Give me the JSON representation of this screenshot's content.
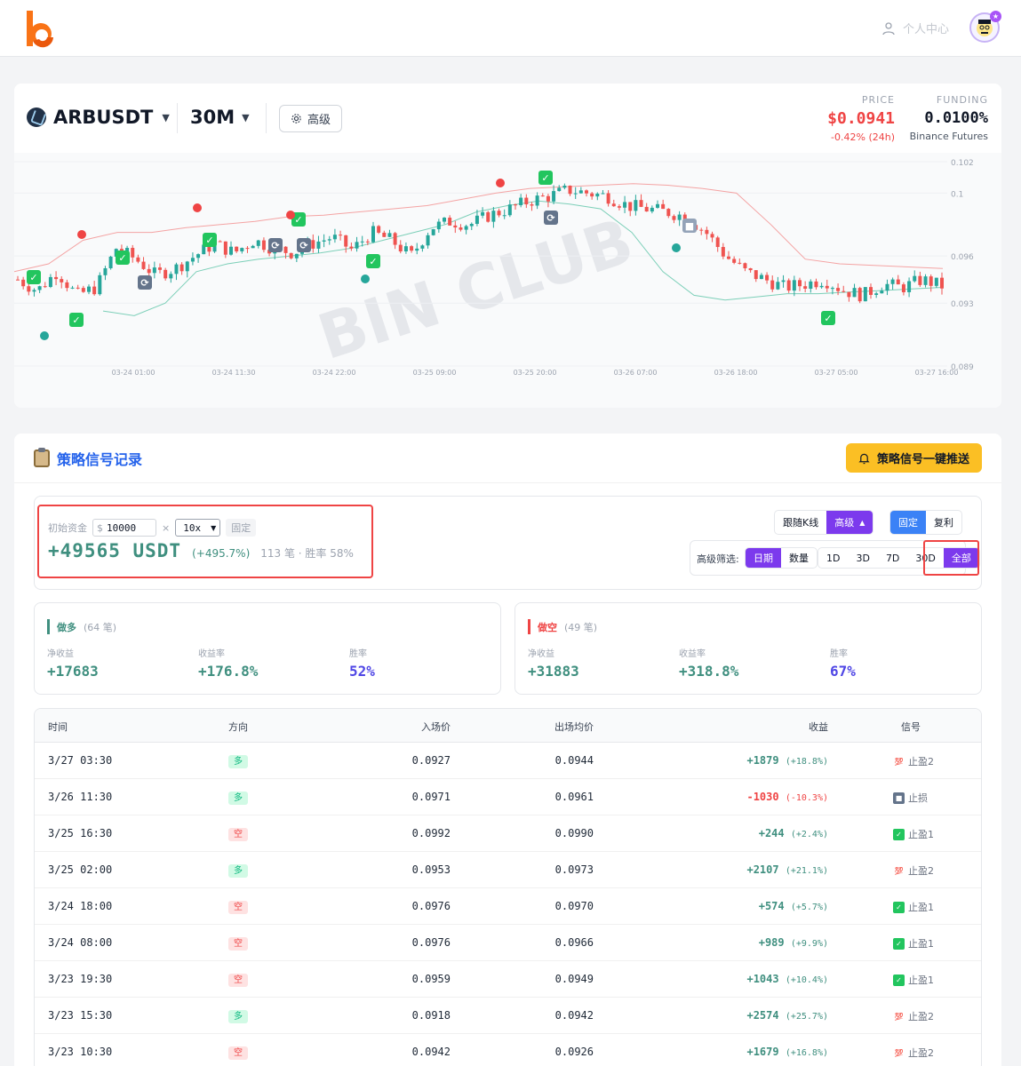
{
  "header": {
    "user_center": "个人中心"
  },
  "ticker": {
    "symbol": "ARBUSDT",
    "timeframe": "30M",
    "advanced_label": "高级",
    "price_label": "PRICE",
    "price": "$0.0941",
    "change": "-0.42% (24h)",
    "funding_label": "FUNDING",
    "funding": "0.0100%",
    "exchange": "Binance Futures"
  },
  "chart_data": {
    "type": "candlestick",
    "watermark": "BIN CLUB",
    "y_ticks": [
      "0.102",
      "0.1",
      "0.096",
      "0.093",
      "0.089"
    ],
    "x_ticks": [
      "03-24 01:00",
      "03-24 11:30",
      "03-24 22:00",
      "03-25 09:00",
      "03-25 20:00",
      "03-26 07:00",
      "03-26 18:00",
      "03-27 05:00",
      "03-27 16:00"
    ],
    "ylim": [
      0.089,
      0.102
    ],
    "close_path": [
      0.0945,
      0.0938,
      0.095,
      0.0935,
      0.094,
      0.0965,
      0.0958,
      0.0948,
      0.0952,
      0.096,
      0.0968,
      0.0962,
      0.097,
      0.0965,
      0.0962,
      0.0968,
      0.0972,
      0.0964,
      0.0975,
      0.097,
      0.096,
      0.0978,
      0.0982,
      0.098,
      0.0986,
      0.099,
      0.0995,
      0.0998,
      0.1002,
      0.1,
      0.0998,
      0.0992,
      0.099,
      0.0988,
      0.0985,
      0.0975,
      0.096,
      0.095,
      0.0945,
      0.094,
      0.0942,
      0.0945,
      0.0938,
      0.0935,
      0.0942,
      0.094,
      0.0945,
      0.0941
    ],
    "upper_band": [
      0.095,
      0.0955,
      0.097,
      0.0975,
      0.0975,
      0.0978,
      0.098,
      0.0982,
      0.0985,
      0.0986,
      0.0988,
      0.099,
      0.0992,
      0.0996,
      0.1,
      0.1003,
      0.1004,
      0.1005,
      0.1006,
      0.1005,
      0.1003,
      0.1,
      0.098,
      0.0958,
      0.0955,
      0.0954,
      0.0953,
      0.0952
    ],
    "lower_band": [
      0.0925,
      0.0922,
      0.093,
      0.095,
      0.0955,
      0.0958,
      0.096,
      0.0962,
      0.0965,
      0.097,
      0.0975,
      0.098,
      0.0988,
      0.0992,
      0.0995,
      0.0993,
      0.099,
      0.0975,
      0.095,
      0.0935,
      0.0932,
      0.0934,
      0.0936,
      0.0936,
      0.0937,
      0.0938,
      0.0939,
      0.094
    ]
  },
  "signals": {
    "title": "策略信号记录",
    "push_button": "策略信号一键推送",
    "initial_capital_label": "初始资金",
    "currency": "$",
    "initial_capital": "10000",
    "times": "×",
    "leverage": "10x",
    "fixed_tag": "固定",
    "total_profit": "+49565 USDT",
    "total_pct": "(+495.7%)",
    "summary": "113 笔 · 胜率 58%",
    "follow_kline": "跟随K线",
    "advanced": "高级",
    "mode_fixed": "固定",
    "mode_compound": "复利",
    "filter_label": "高级筛选:",
    "filter_date": "日期",
    "filter_count": "数量",
    "range_1d": "1D",
    "range_3d": "3D",
    "range_7d": "7D",
    "range_30d": "30D",
    "range_all": "全部"
  },
  "long_stats": {
    "title": "做多",
    "count": "(64 笔)",
    "net_label": "净收益",
    "net": "+17683",
    "rate_label": "收益率",
    "rate": "+176.8%",
    "win_label": "胜率",
    "win": "52%"
  },
  "short_stats": {
    "title": "做空",
    "count": "(49 笔)",
    "net_label": "净收益",
    "net": "+31883",
    "rate_label": "收益率",
    "rate": "+318.8%",
    "win_label": "胜率",
    "win": "67%"
  },
  "table": {
    "headers": {
      "time": "时间",
      "direction": "方向",
      "entry": "入场价",
      "exit": "出场均价",
      "pnl": "收益",
      "signal": "信号"
    },
    "rows": [
      {
        "time": "3/27 03:30",
        "dir": "多",
        "entry": "0.0927",
        "exit": "0.0944",
        "pnl": "+1879",
        "pct": "(+18.8%)",
        "sig": "止盈2"
      },
      {
        "time": "3/26 11:30",
        "dir": "多",
        "entry": "0.0971",
        "exit": "0.0961",
        "pnl": "-1030",
        "pct": "(-10.3%)",
        "sig": "止损"
      },
      {
        "time": "3/25 16:30",
        "dir": "空",
        "entry": "0.0992",
        "exit": "0.0990",
        "pnl": "+244",
        "pct": "(+2.4%)",
        "sig": "止盈1"
      },
      {
        "time": "3/25 02:00",
        "dir": "多",
        "entry": "0.0953",
        "exit": "0.0973",
        "pnl": "+2107",
        "pct": "(+21.1%)",
        "sig": "止盈2"
      },
      {
        "time": "3/24 18:00",
        "dir": "空",
        "entry": "0.0976",
        "exit": "0.0970",
        "pnl": "+574",
        "pct": "(+5.7%)",
        "sig": "止盈1"
      },
      {
        "time": "3/24 08:00",
        "dir": "空",
        "entry": "0.0976",
        "exit": "0.0966",
        "pnl": "+989",
        "pct": "(+9.9%)",
        "sig": "止盈1"
      },
      {
        "time": "3/23 19:30",
        "dir": "空",
        "entry": "0.0959",
        "exit": "0.0949",
        "pnl": "+1043",
        "pct": "(+10.4%)",
        "sig": "止盈1"
      },
      {
        "time": "3/23 15:30",
        "dir": "多",
        "entry": "0.0918",
        "exit": "0.0942",
        "pnl": "+2574",
        "pct": "(+25.7%)",
        "sig": "止盈2"
      },
      {
        "time": "3/23 10:30",
        "dir": "空",
        "entry": "0.0942",
        "exit": "0.0926",
        "pnl": "+1679",
        "pct": "(+16.8%)",
        "sig": "止盈2"
      }
    ]
  }
}
